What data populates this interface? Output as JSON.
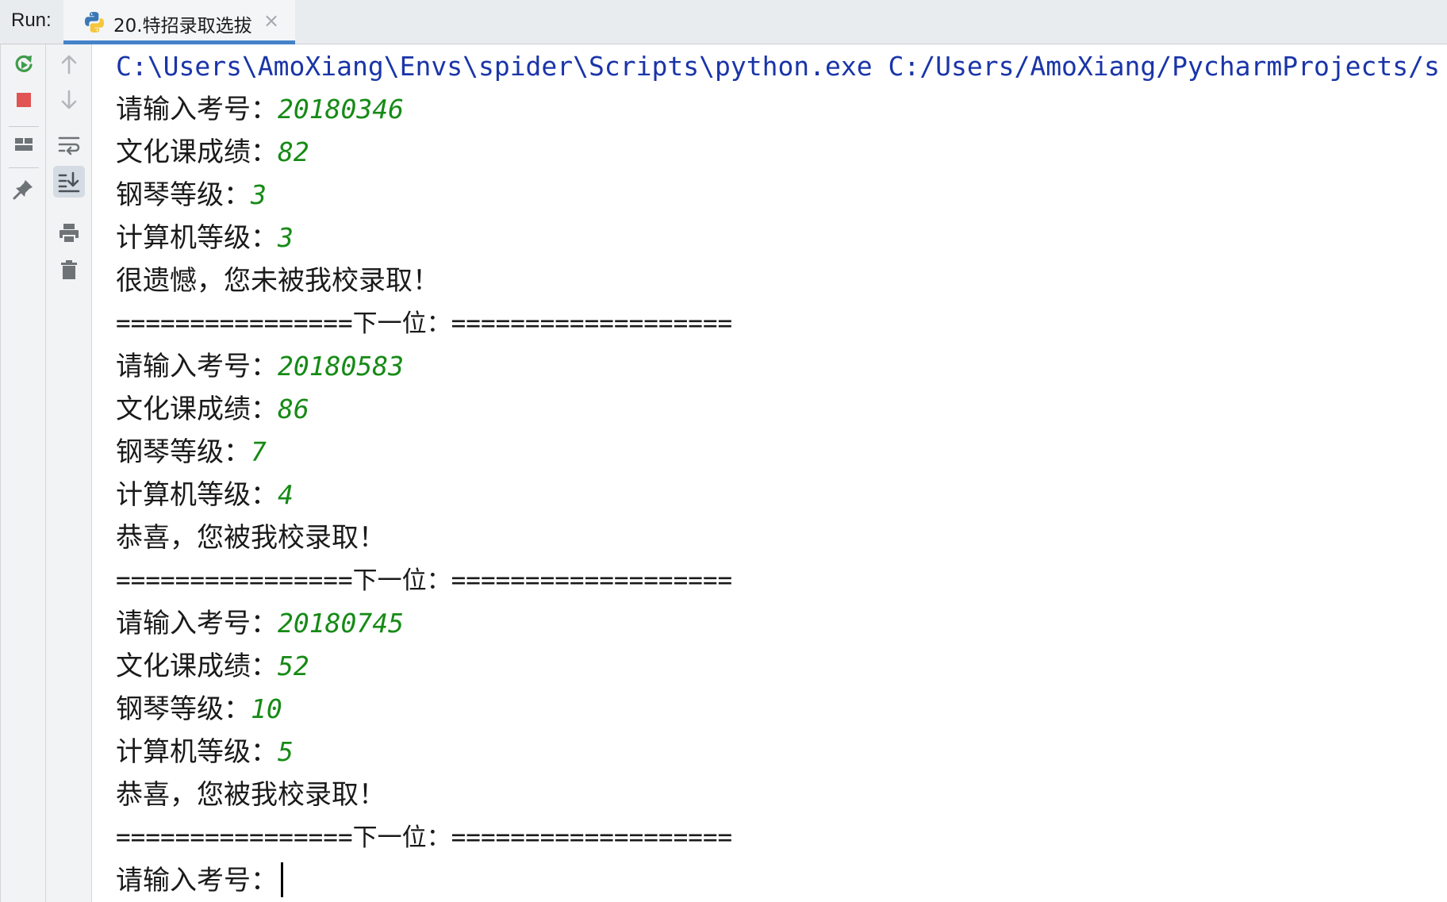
{
  "tabbar": {
    "run_label": "Run:",
    "tab_title": "20.特招录取选拔",
    "close_glyph": "×",
    "accent": "#4682c9"
  },
  "toolbar_left": [
    {
      "icon": "rerun-icon"
    },
    {
      "icon": "stop-icon"
    },
    {
      "icon": "layout-icon"
    },
    {
      "icon": "pin-icon"
    }
  ],
  "toolbar_right": [
    {
      "icon": "arrow-up-icon"
    },
    {
      "icon": "arrow-down-icon"
    },
    {
      "icon": "soft-wrap-icon"
    },
    {
      "icon": "scroll-to-end-icon",
      "active": true
    },
    {
      "icon": "print-icon"
    },
    {
      "icon": "trash-icon"
    }
  ],
  "console": {
    "command": "C:\\Users\\AmoXiang\\Envs\\spider\\Scripts\\python.exe C:/Users/AmoXiang/PycharmProjects/s",
    "colors": {
      "command": "#1a35a8",
      "input": "#168a16",
      "text": "#1a1a1a"
    },
    "lines": [
      {
        "kind": "prompt",
        "text": "请输入考号：",
        "value": "20180346"
      },
      {
        "kind": "prompt",
        "text": "文化课成绩：",
        "value": "82"
      },
      {
        "kind": "prompt",
        "text": "钢琴等级：",
        "value": "3"
      },
      {
        "kind": "prompt",
        "text": "计算机等级：",
        "value": "3"
      },
      {
        "kind": "output",
        "text": "很遗憾，您未被我校录取！"
      },
      {
        "kind": "sep",
        "text": "================下一位：==================="
      },
      {
        "kind": "prompt",
        "text": "请输入考号：",
        "value": "20180583"
      },
      {
        "kind": "prompt",
        "text": "文化课成绩：",
        "value": "86"
      },
      {
        "kind": "prompt",
        "text": "钢琴等级：",
        "value": "7"
      },
      {
        "kind": "prompt",
        "text": "计算机等级：",
        "value": "4"
      },
      {
        "kind": "output",
        "text": "恭喜，您被我校录取！"
      },
      {
        "kind": "sep",
        "text": "================下一位：==================="
      },
      {
        "kind": "prompt",
        "text": "请输入考号：",
        "value": "20180745"
      },
      {
        "kind": "prompt",
        "text": "文化课成绩：",
        "value": "52"
      },
      {
        "kind": "prompt",
        "text": "钢琴等级：",
        "value": "10"
      },
      {
        "kind": "prompt",
        "text": "计算机等级：",
        "value": "5"
      },
      {
        "kind": "output",
        "text": "恭喜，您被我校录取！"
      },
      {
        "kind": "sep",
        "text": "================下一位：==================="
      },
      {
        "kind": "prompt-active",
        "text": "请输入考号："
      }
    ]
  }
}
